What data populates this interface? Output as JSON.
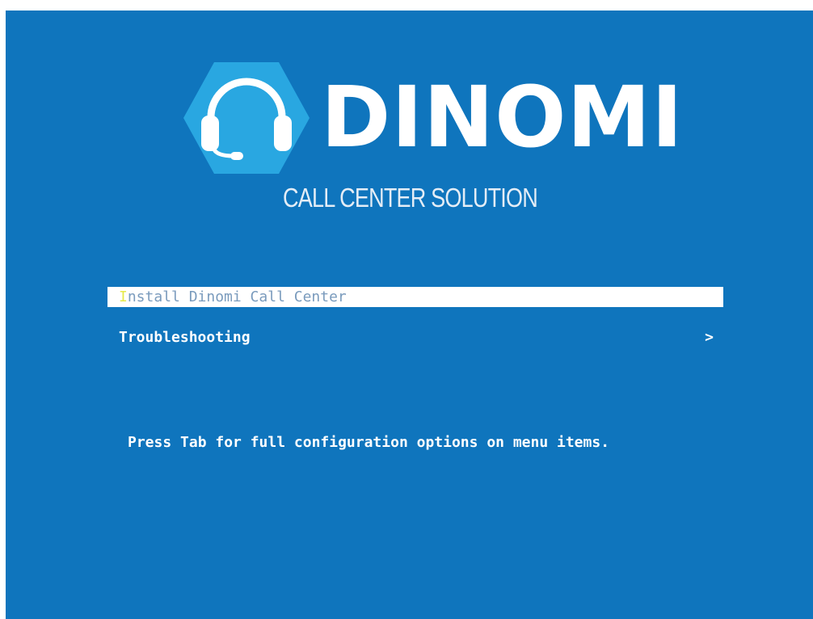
{
  "colors": {
    "background": "#0f75bd",
    "logo_hexagon": "#29a7e1",
    "menu_selected_bg": "#ffffff",
    "menu_selected_text": "#7a9bbd",
    "hotkey": "#e6e94a"
  },
  "logo": {
    "icon": "headset-icon",
    "brand": "DINOMI",
    "tagline": "CALL CENTER SOLUTION"
  },
  "menu": {
    "items": [
      {
        "hotkey": "I",
        "rest": "nstall Dinomi Call Center",
        "selected": true
      },
      {
        "label": "Troubleshooting",
        "submenu_indicator": ">",
        "selected": false
      }
    ]
  },
  "hint": "Press Tab for full configuration options on menu items."
}
